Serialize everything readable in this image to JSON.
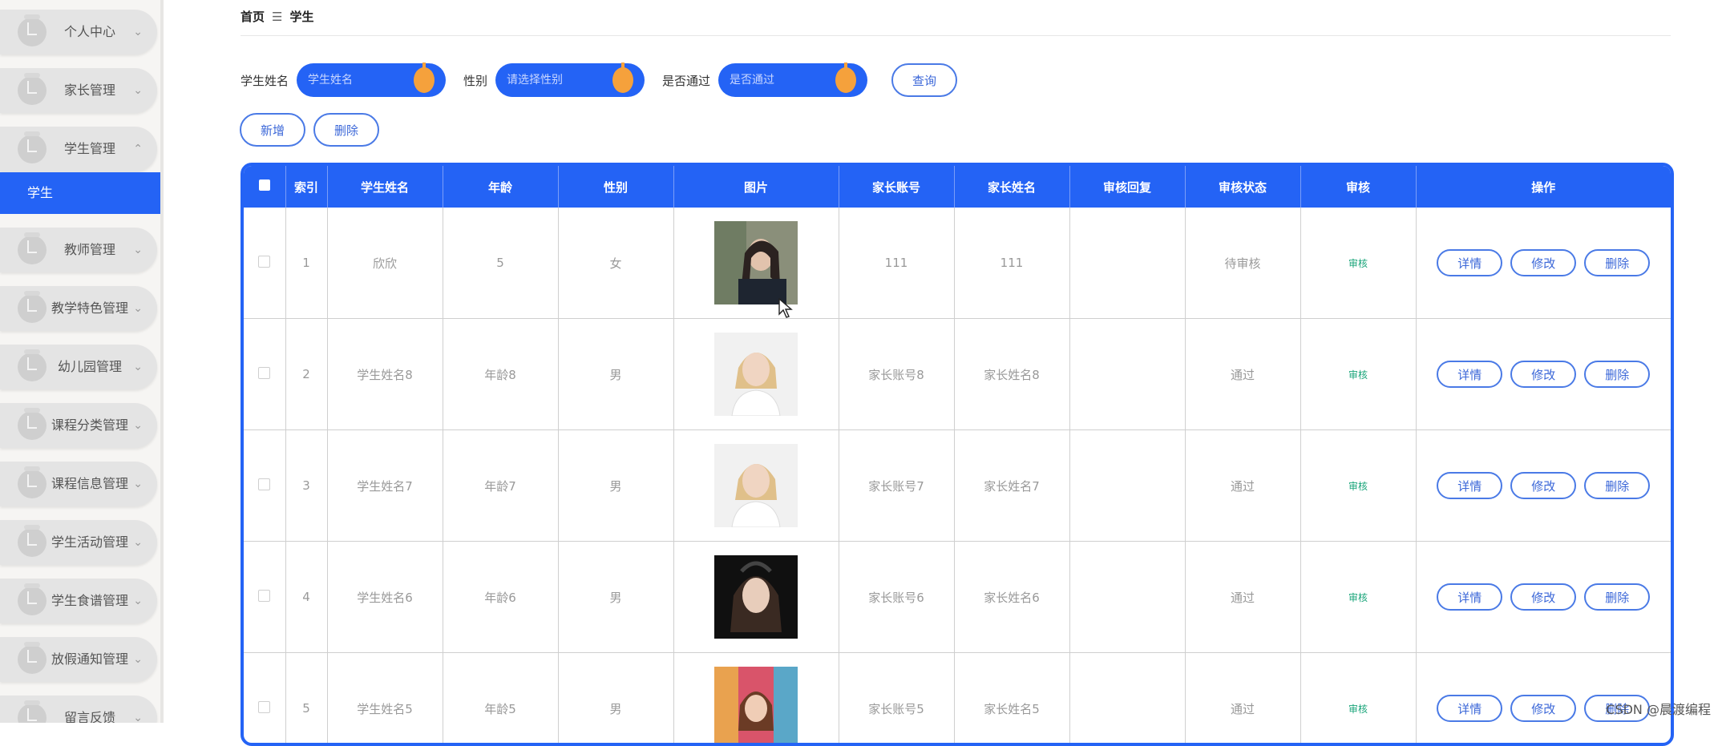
{
  "sidebar": {
    "items": [
      {
        "label": "个人中心",
        "chevron": "⌄"
      },
      {
        "label": "家长管理",
        "chevron": "⌄"
      },
      {
        "label": "学生管理",
        "chevron": "⌃"
      },
      {
        "label": "教师管理",
        "chevron": "⌄"
      },
      {
        "label": "教学特色管理",
        "chevron": "⌄"
      },
      {
        "label": "幼儿园管理",
        "chevron": "⌄"
      },
      {
        "label": "课程分类管理",
        "chevron": "⌄"
      },
      {
        "label": "课程信息管理",
        "chevron": "⌄"
      },
      {
        "label": "学生活动管理",
        "chevron": "⌄"
      },
      {
        "label": "学生食谱管理",
        "chevron": "⌄"
      },
      {
        "label": "放假通知管理",
        "chevron": "⌄"
      },
      {
        "label": "留言反馈",
        "chevron": "⌄"
      }
    ],
    "active_sub": "学生"
  },
  "breadcrumb": {
    "home": "首页",
    "sep": "☰",
    "current": "学生"
  },
  "search": {
    "name_label": "学生姓名",
    "name_placeholder": "学生姓名",
    "gender_label": "性别",
    "gender_placeholder": "请选择性别",
    "pass_label": "是否通过",
    "pass_placeholder": "是否通过",
    "query": "查询"
  },
  "actions": {
    "add": "新增",
    "delete": "删除"
  },
  "table": {
    "headers": [
      "索引",
      "学生姓名",
      "年龄",
      "性别",
      "图片",
      "家长账号",
      "家长姓名",
      "审核回复",
      "审核状态",
      "审核",
      "操作"
    ],
    "rows": [
      {
        "idx": "1",
        "name": "欣欣",
        "age": "5",
        "gender": "女",
        "parent_account": "111",
        "parent_name": "111",
        "reply": "",
        "status": "待审核",
        "audit": "审核"
      },
      {
        "idx": "2",
        "name": "学生姓名8",
        "age": "年龄8",
        "gender": "男",
        "parent_account": "家长账号8",
        "parent_name": "家长姓名8",
        "reply": "",
        "status": "通过",
        "audit": "审核"
      },
      {
        "idx": "3",
        "name": "学生姓名7",
        "age": "年龄7",
        "gender": "男",
        "parent_account": "家长账号7",
        "parent_name": "家长姓名7",
        "reply": "",
        "status": "通过",
        "audit": "审核"
      },
      {
        "idx": "4",
        "name": "学生姓名6",
        "age": "年龄6",
        "gender": "男",
        "parent_account": "家长账号6",
        "parent_name": "家长姓名6",
        "reply": "",
        "status": "通过",
        "audit": "审核"
      },
      {
        "idx": "5",
        "name": "学生姓名5",
        "age": "年龄5",
        "gender": "男",
        "parent_account": "家长账号5",
        "parent_name": "家长姓名5",
        "reply": "",
        "status": "通过",
        "audit": "审核"
      }
    ],
    "ops": {
      "detail": "详情",
      "edit": "修改",
      "delete": "删除"
    }
  },
  "watermark": "CSDN @晨渡编程",
  "colors": {
    "primary": "#2463f5",
    "knob": "#f5a13c",
    "audit": "#1aa57a"
  }
}
